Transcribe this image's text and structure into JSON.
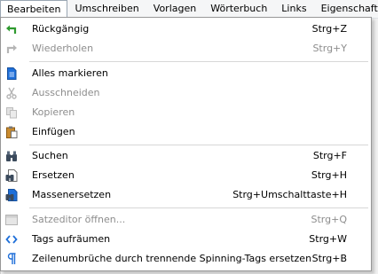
{
  "menubar": {
    "tabs": [
      "Bearbeiten",
      "Umschreiben",
      "Vorlagen",
      "Wörterbuch",
      "Links",
      "Eigenschaften"
    ]
  },
  "menu": {
    "undo": {
      "label": "Rückgängig",
      "shortcut": "Strg+Z",
      "icon": "undo-icon",
      "enabled": true
    },
    "redo": {
      "label": "Wiederholen",
      "shortcut": "Strg+Y",
      "icon": "redo-icon",
      "enabled": false
    },
    "select_all": {
      "label": "Alles markieren",
      "icon": "document-icon",
      "enabled": true
    },
    "cut": {
      "label": "Ausschneiden",
      "icon": "scissors-icon",
      "enabled": false
    },
    "copy": {
      "label": "Kopieren",
      "icon": "copy-icon",
      "enabled": false
    },
    "paste": {
      "label": "Einfügen",
      "icon": "paste-icon",
      "enabled": true
    },
    "find": {
      "label": "Suchen",
      "shortcut": "Strg+F",
      "icon": "binoculars-icon",
      "enabled": true
    },
    "replace": {
      "label": "Ersetzen",
      "shortcut": "Strg+H",
      "icon": "find-replace-icon",
      "enabled": true
    },
    "mass_replace": {
      "label": "Massenersetzen",
      "shortcut": "Strg+Umschalttaste+H",
      "icon": "mass-replace-icon",
      "enabled": true
    },
    "sentence_editor": {
      "label": "Satzeditor öffnen...",
      "shortcut": "Strg+Q",
      "icon": "window-icon",
      "enabled": false
    },
    "tidy_tags": {
      "label": "Tags aufräumen",
      "shortcut": "Strg+W",
      "icon": "code-tags-icon",
      "enabled": true
    },
    "linebreaks": {
      "label": "Zeilenumbrüche durch trennende Spinning-Tags ersetzen",
      "shortcut": "Strg+B",
      "icon": "pilcrow-icon",
      "enabled": true
    }
  }
}
